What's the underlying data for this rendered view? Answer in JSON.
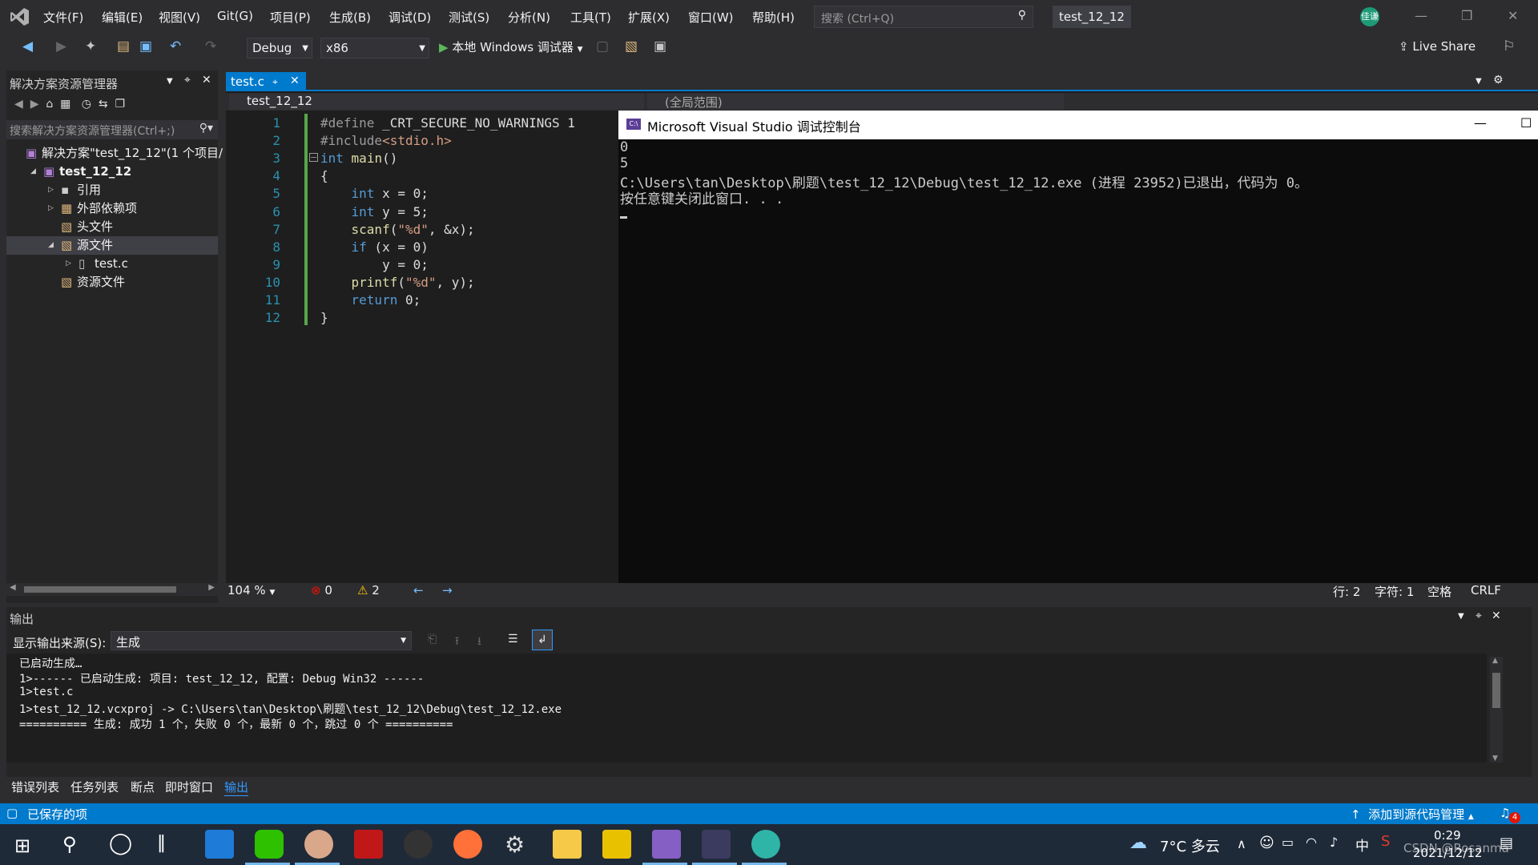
{
  "menu": [
    "文件(F)",
    "编辑(E)",
    "视图(V)",
    "Git(G)",
    "项目(P)",
    "生成(B)",
    "调试(D)",
    "测试(S)",
    "分析(N)",
    "工具(T)",
    "扩展(X)",
    "窗口(W)",
    "帮助(H)"
  ],
  "search": {
    "placeholder": "搜索 (Ctrl+Q)"
  },
  "window_title": "test_12_12",
  "avatar_text": "佳谦",
  "toolbar": {
    "config": "Debug",
    "platform": "x86",
    "run_label": "本地 Windows 调试器",
    "live_share": "Live Share"
  },
  "solution_explorer": {
    "title": "解决方案资源管理器",
    "search_placeholder": "搜索解决方案资源管理器(Ctrl+;)",
    "items": [
      {
        "label": "解决方案\"test_12_12\"(1 个项目/",
        "indent": 0
      },
      {
        "label": "test_12_12",
        "indent": 1
      },
      {
        "label": "引用",
        "indent": 2
      },
      {
        "label": "外部依赖项",
        "indent": 2
      },
      {
        "label": "头文件",
        "indent": 2
      },
      {
        "label": "源文件",
        "indent": 2
      },
      {
        "label": "test.c",
        "indent": 3
      },
      {
        "label": "资源文件",
        "indent": 2
      }
    ]
  },
  "editor": {
    "tab": "test.c",
    "nav_left": "test_12_12",
    "nav_mid": "(全局范围)",
    "zoom": "104 %",
    "errors": "0",
    "warnings": "2",
    "line": "行: 2",
    "char": "字符: 1",
    "spaces": "空格",
    "eol": "CRLF"
  },
  "code": [
    "#define _CRT_SECURE_NO_WARNINGS 1",
    "#include<stdio.h>",
    "int main()",
    "{",
    "    int x = 0;",
    "    int y = 5;",
    "    scanf(\"%d\", &x);",
    "    if (x = 0)",
    "        y = 0;",
    "    printf(\"%d\", y);",
    "    return 0;",
    "}"
  ],
  "console": {
    "title": "Microsoft Visual Studio 调试控制台",
    "lines": [
      "0",
      "5",
      "C:\\Users\\tan\\Desktop\\刷题\\test_12_12\\Debug\\test_12_12.exe (进程 23952)已退出，代码为 0。",
      "按任意键关闭此窗口. . ."
    ]
  },
  "output": {
    "title": "输出",
    "source_label": "显示输出来源(S):",
    "source_value": "生成",
    "lines": [
      "已启动生成…",
      "1>------ 已启动生成: 项目: test_12_12, 配置: Debug Win32 ------",
      "1>test.c",
      "1>test_12_12.vcxproj -> C:\\Users\\tan\\Desktop\\刷题\\test_12_12\\Debug\\test_12_12.exe",
      "========== 生成: 成功 1 个，失败 0 个，最新 0 个，跳过 0 个 =========="
    ]
  },
  "bottom_tabs": [
    "错误列表",
    "任务列表",
    "断点",
    "即时窗口",
    "输出"
  ],
  "statusbar": {
    "left": "已保存的项",
    "right": "添加到源代码管理",
    "notifications": "4"
  },
  "taskbar": {
    "weather": "7°C 多云",
    "time": "0:29",
    "date": "2021/12/12",
    "ime": "中",
    "watermark": "CSDN @Rosanma"
  },
  "colors": {
    "accent": "#007acc",
    "editor_bg": "#1e1e1e",
    "console_bg": "#0c0c0c"
  }
}
